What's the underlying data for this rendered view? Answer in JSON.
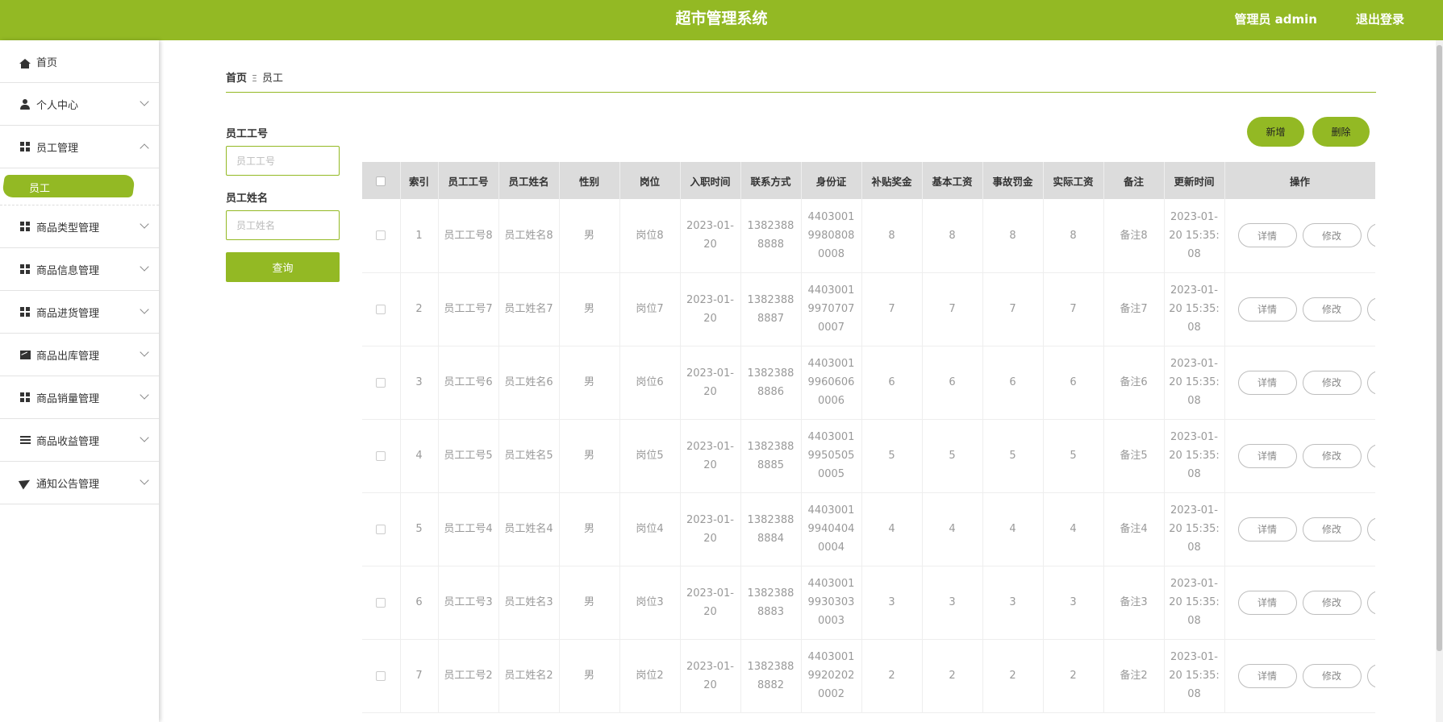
{
  "header": {
    "title": "超市管理系统",
    "user_label": "管理员 admin",
    "logout_label": "退出登录"
  },
  "sidebar": {
    "items": [
      {
        "label": "首页",
        "icon": "home-icon"
      },
      {
        "label": "个人中心",
        "icon": "user-icon"
      },
      {
        "label": "员工管理",
        "icon": "grid-icon"
      },
      {
        "label": "商品类型管理",
        "icon": "grid-icon"
      },
      {
        "label": "商品信息管理",
        "icon": "grid-icon"
      },
      {
        "label": "商品进货管理",
        "icon": "grid-icon"
      },
      {
        "label": "商品出库管理",
        "icon": "chart-icon"
      },
      {
        "label": "商品销量管理",
        "icon": "grid-icon"
      },
      {
        "label": "商品收益管理",
        "icon": "list-icon"
      },
      {
        "label": "通知公告管理",
        "icon": "send-icon"
      }
    ],
    "active_sub": "员工"
  },
  "breadcrumb": {
    "home": "首页",
    "separator": "Ξ",
    "current": "员工"
  },
  "search": {
    "field1_label": "员工工号",
    "field1_placeholder": "员工工号",
    "field2_label": "员工姓名",
    "field2_placeholder": "员工姓名",
    "button": "查询"
  },
  "actions": {
    "add": "新增",
    "delete": "删除"
  },
  "table": {
    "columns": [
      "索引",
      "员工工号",
      "员工姓名",
      "性别",
      "岗位",
      "入职时间",
      "联系方式",
      "身份证",
      "补贴奖金",
      "基本工资",
      "事故罚金",
      "实际工资",
      "备注",
      "更新时间",
      "操作"
    ],
    "detail_label": "详情",
    "edit_label": "修改",
    "rows": [
      {
        "idx": "1",
        "no": "员工工号8",
        "name": "员工姓名8",
        "gender": "男",
        "post": "岗位8",
        "hire": "2023-01-20",
        "phone": "13823888888",
        "id_card": "440300199808080008",
        "bonus": "8",
        "base": "8",
        "fine": "8",
        "actual": "8",
        "remark": "备注8",
        "updated": "2023-01-20 15:35:08"
      },
      {
        "idx": "2",
        "no": "员工工号7",
        "name": "员工姓名7",
        "gender": "男",
        "post": "岗位7",
        "hire": "2023-01-20",
        "phone": "13823888887",
        "id_card": "440300199707070007",
        "bonus": "7",
        "base": "7",
        "fine": "7",
        "actual": "7",
        "remark": "备注7",
        "updated": "2023-01-20 15:35:08"
      },
      {
        "idx": "3",
        "no": "员工工号6",
        "name": "员工姓名6",
        "gender": "男",
        "post": "岗位6",
        "hire": "2023-01-20",
        "phone": "13823888886",
        "id_card": "440300199606060006",
        "bonus": "6",
        "base": "6",
        "fine": "6",
        "actual": "6",
        "remark": "备注6",
        "updated": "2023-01-20 15:35:08"
      },
      {
        "idx": "4",
        "no": "员工工号5",
        "name": "员工姓名5",
        "gender": "男",
        "post": "岗位5",
        "hire": "2023-01-20",
        "phone": "13823888885",
        "id_card": "440300199505050005",
        "bonus": "5",
        "base": "5",
        "fine": "5",
        "actual": "5",
        "remark": "备注5",
        "updated": "2023-01-20 15:35:08"
      },
      {
        "idx": "5",
        "no": "员工工号4",
        "name": "员工姓名4",
        "gender": "男",
        "post": "岗位4",
        "hire": "2023-01-20",
        "phone": "13823888884",
        "id_card": "440300199404040004",
        "bonus": "4",
        "base": "4",
        "fine": "4",
        "actual": "4",
        "remark": "备注4",
        "updated": "2023-01-20 15:35:08"
      },
      {
        "idx": "6",
        "no": "员工工号3",
        "name": "员工姓名3",
        "gender": "男",
        "post": "岗位3",
        "hire": "2023-01-20",
        "phone": "13823888883",
        "id_card": "440300199303030003",
        "bonus": "3",
        "base": "3",
        "fine": "3",
        "actual": "3",
        "remark": "备注3",
        "updated": "2023-01-20 15:35:08"
      },
      {
        "idx": "7",
        "no": "员工工号2",
        "name": "员工姓名2",
        "gender": "男",
        "post": "岗位2",
        "hire": "2023-01-20",
        "phone": "13823888882",
        "id_card": "440300199202020002",
        "bonus": "2",
        "base": "2",
        "fine": "2",
        "actual": "2",
        "remark": "备注2",
        "updated": "2023-01-20 15:35:08"
      }
    ]
  },
  "colors": {
    "accent": "#93b924",
    "header_bg": "#93b924",
    "table_header_bg": "#dcdcdc"
  }
}
